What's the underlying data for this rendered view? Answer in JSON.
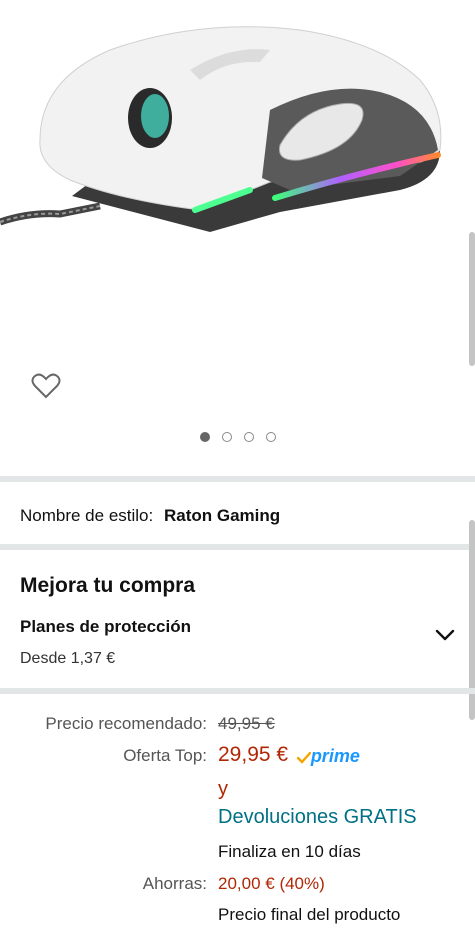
{
  "product": {
    "image_alt": "Ratón gaming blanco con iluminación RGB",
    "carousel_total": 4,
    "carousel_active": 1
  },
  "style": {
    "label": "Nombre de estilo:",
    "value": "Raton Gaming"
  },
  "upgrade": {
    "title": "Mejora tu compra",
    "plans_title": "Planes de protección",
    "plans_price": "Desde 1,37 €"
  },
  "pricing": {
    "recommended_label": "Precio recomendado:",
    "recommended_value": "49,95 €",
    "offer_label": "Oferta Top:",
    "offer_value": "29,95 €",
    "prime_label": "prime",
    "and_text": "y",
    "returns_text": "Devoluciones GRATIS",
    "ends_text": "Finaliza en 10 días",
    "savings_label": "Ahorras:",
    "savings_value": "20,00 € (40%)",
    "final_text": "Precio final del producto"
  },
  "colors": {
    "price_red": "#b12704",
    "link_teal": "#007185",
    "prime_blue": "#1a98ff",
    "prime_check": "#f7a300",
    "divider": "#e3e6e6"
  },
  "icons": [
    "heart-icon",
    "chevron-down-icon",
    "prime-check-icon"
  ]
}
